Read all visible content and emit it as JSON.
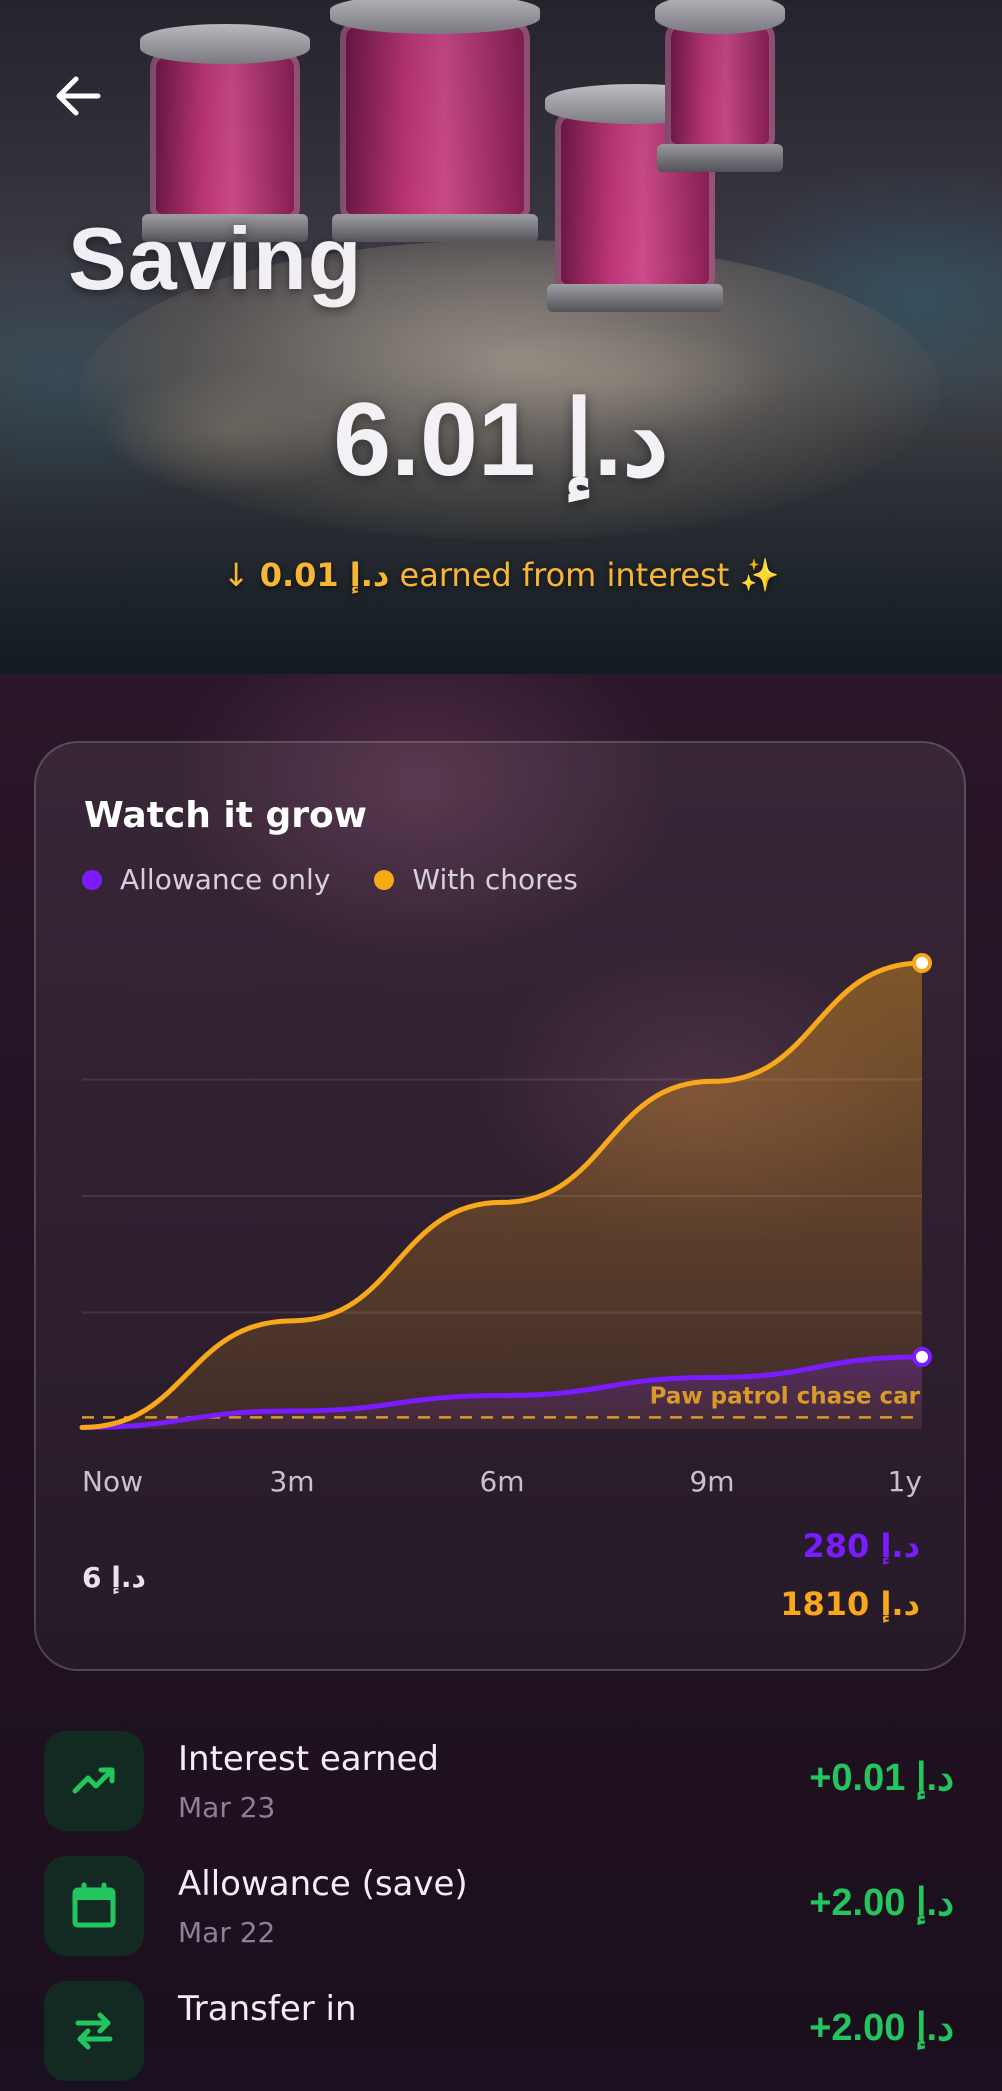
{
  "header": {
    "title": "Saving",
    "balance": "6.01 د.إ",
    "interest_prefix": "↓",
    "interest_amount": "0.01 د.إ",
    "interest_text": "earned from interest ✨",
    "back_icon": "arrow-left-icon"
  },
  "growth_card": {
    "title": "Watch it grow",
    "legend": [
      {
        "label": "Allowance only",
        "color": "#7a1cff"
      },
      {
        "label": "With chores",
        "color": "#f7a81b"
      }
    ],
    "goal_label": "Paw patrol chase car",
    "start_value": "6 د.إ",
    "end_allowance": "280 د.إ",
    "end_chores": "1810 د.إ"
  },
  "chart_data": {
    "type": "area",
    "x": [
      "Now",
      "3m",
      "6m",
      "9m",
      "1y"
    ],
    "series": [
      {
        "name": "Allowance only",
        "color": "#7a1cff",
        "values": [
          6,
          70,
          130,
          200,
          280
        ]
      },
      {
        "name": "With chores",
        "color": "#f7a81b",
        "values": [
          6,
          420,
          880,
          1350,
          1810
        ]
      }
    ],
    "goal_line": {
      "label": "Paw patrol chase car",
      "value": 45,
      "color": "#d99a2b"
    },
    "ylim": [
      0,
      1810
    ],
    "grid": true,
    "legend_position": "top-left"
  },
  "transactions": [
    {
      "title": "Interest earned",
      "date": "Mar 23",
      "amount": "+0.01 د.إ",
      "icon": "trending-up-icon"
    },
    {
      "title": "Allowance (save)",
      "date": "Mar 22",
      "amount": "+2.00 د.إ",
      "icon": "calendar-icon"
    },
    {
      "title": "Transfer in",
      "date": "",
      "amount": "+2.00 د.إ",
      "icon": "transfer-arrows-icon"
    }
  ]
}
